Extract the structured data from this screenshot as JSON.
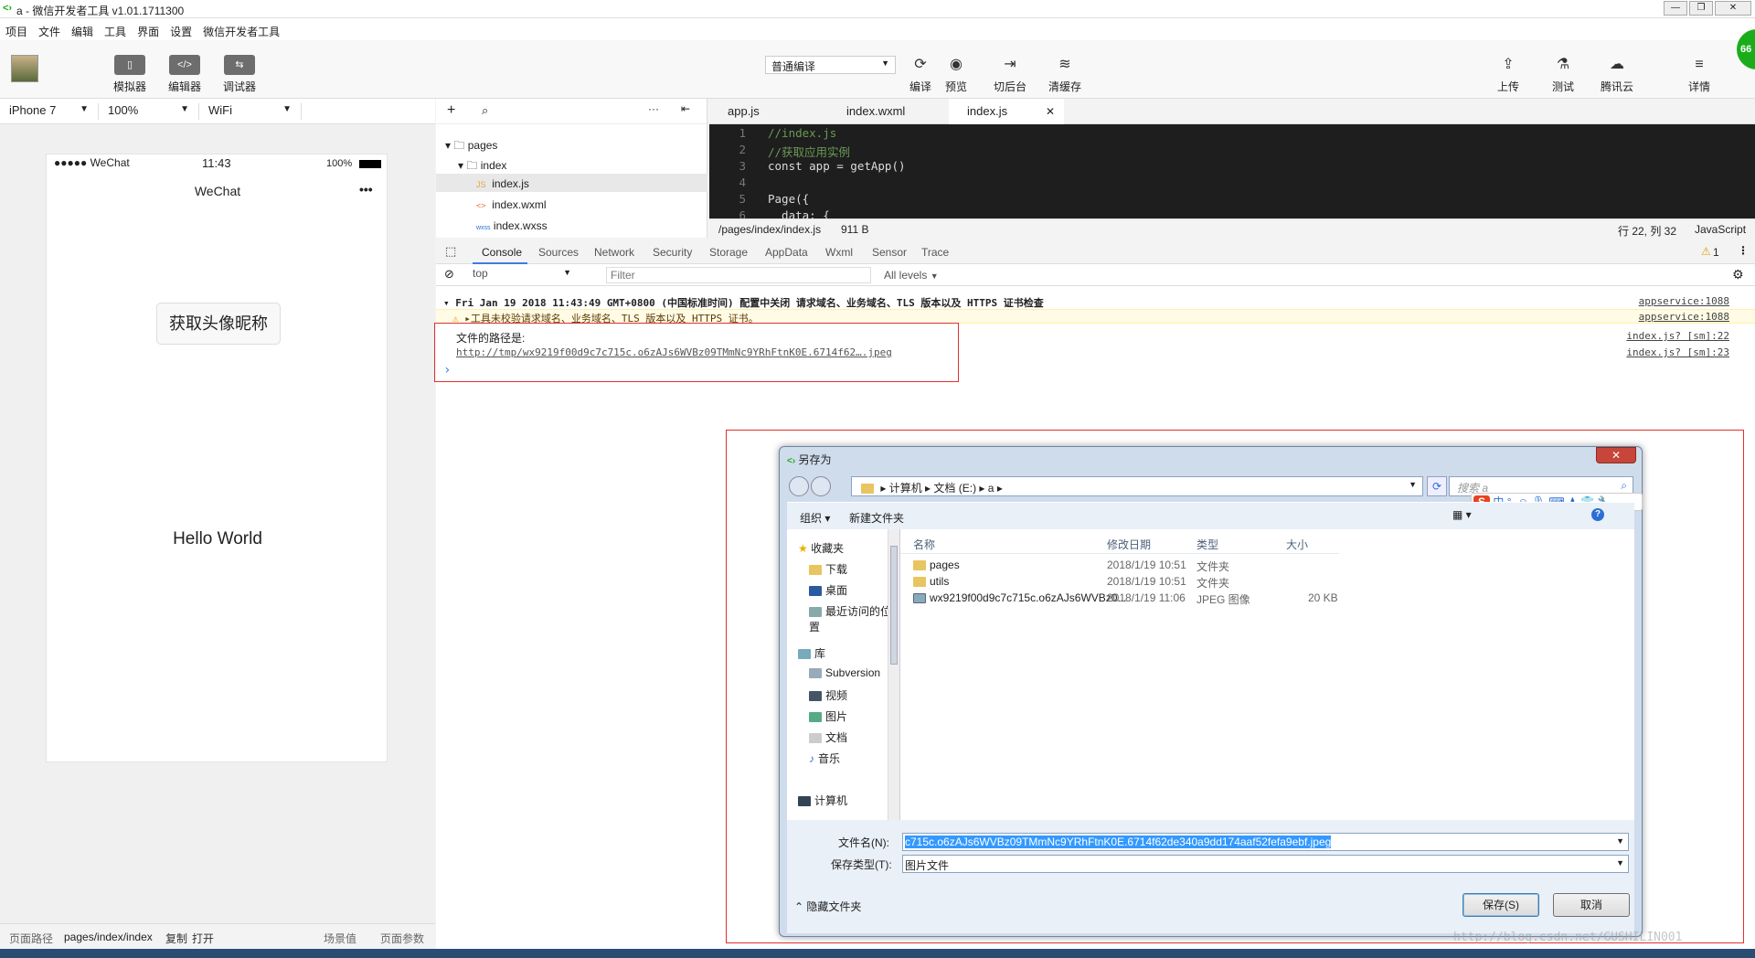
{
  "window": {
    "title": "a - 微信开发者工具 v1.01.1711300"
  },
  "menu": [
    "项目",
    "文件",
    "编辑",
    "工具",
    "界面",
    "设置",
    "微信开发者工具"
  ],
  "toolbar": {
    "simulator": "模拟器",
    "editor": "编辑器",
    "debugger": "调试器",
    "compile_mode": "普通编译",
    "compile": "编译",
    "preview": "预览",
    "background": "切后台",
    "clear_cache": "清缓存",
    "upload": "上传",
    "test": "测试",
    "tencent_cloud": "腾讯云",
    "details": "详情",
    "badge": "66"
  },
  "simulator": {
    "device": "iPhone 7",
    "zoom": "100%",
    "network": "WiFi",
    "status_carrier": "●●●●● WeChat",
    "status_time": "11:43",
    "status_battery": "100%",
    "nav_title": "WeChat",
    "nav_more": "•••",
    "button_label": "获取头像昵称",
    "hello": "Hello World"
  },
  "simfooter": {
    "path_label": "页面路径",
    "path": "pages/index/index",
    "copy": "复制",
    "open": "打开",
    "scene": "场景值",
    "params": "页面参数"
  },
  "filetree": {
    "root": "pages",
    "folder": "index",
    "files": [
      {
        "badge": "JS",
        "name": "index.js"
      },
      {
        "badge": "<>",
        "name": "index.wxml"
      },
      {
        "badge": "wxss",
        "name": "index.wxss"
      }
    ]
  },
  "tabs": [
    "app.js",
    "index.wxml",
    "index.js"
  ],
  "code": {
    "lines": [
      "1",
      "2",
      "3",
      "4",
      "5",
      "6"
    ],
    "text": [
      "//index.js",
      "//获取应用实例",
      "const app = getApp()",
      "",
      "Page({",
      "  data: {"
    ]
  },
  "editor_status": {
    "path": "/pages/index/index.js",
    "size": "911 B",
    "position": "行 22, 列 32",
    "language": "JavaScript"
  },
  "devtools": {
    "tabs": [
      "Console",
      "Sources",
      "Network",
      "Security",
      "Storage",
      "AppData",
      "Wxml",
      "Sensor",
      "Trace"
    ],
    "warn_count": "1",
    "context": "top",
    "filter_placeholder": "Filter",
    "levels": "All levels"
  },
  "console": {
    "line1": "Fri Jan 19 2018 11:43:49 GMT+0800 (中国标准时间) 配置中关闭 请求域名、业务域名、TLS 版本以及 HTTPS 证书检查",
    "line1_src": "appservice:1088",
    "line2": "▸工具未校验请求域名、业务域名、TLS 版本以及 HTTPS 证书。",
    "line2_src": "appservice:1088",
    "line3": "文件的路径是:",
    "line3_src": "index.js? [sm]:22",
    "line4": "http://tmp/wx9219f00d9c7c715c.o6zAJs6WVBz09TMmNc9YRhFtnK0E.6714f62….jpeg",
    "line4_src": "index.js? [sm]:23",
    "prompt": "›"
  },
  "dialog": {
    "title": "另存为",
    "close": "✕",
    "address": [
      "计算机",
      "文档 (E:)",
      "a"
    ],
    "search_placeholder": "搜索 a",
    "organize": "组织 ▾",
    "new_folder": "新建文件夹",
    "nav": {
      "favorites": "收藏夹",
      "downloads": "下载",
      "desktop": "桌面",
      "recent": "最近访问的位置",
      "libraries": "库",
      "subversion": "Subversion",
      "videos": "视频",
      "pictures": "图片",
      "docs": "文档",
      "music": "音乐",
      "computer": "计算机"
    },
    "columns": {
      "name": "名称",
      "date": "修改日期",
      "type": "类型",
      "size": "大小"
    },
    "files": [
      {
        "name": "pages",
        "date": "2018/1/19 10:51",
        "type": "文件夹",
        "size": ""
      },
      {
        "name": "utils",
        "date": "2018/1/19 10:51",
        "type": "文件夹",
        "size": ""
      },
      {
        "name": "wx9219f00d9c7c715c.o6zAJs6WVBz0...",
        "date": "2018/1/19 11:06",
        "type": "JPEG 图像",
        "size": "20 KB"
      }
    ],
    "filename_label": "文件名(N):",
    "filename": "c715c.o6zAJs6WVBz09TMmNc9YRhFtnK0E.6714f62de340a9dd174aaf52fefa9ebf.jpeg",
    "filetype_label": "保存类型(T):",
    "filetype": "图片文件",
    "hide_folders": "隐藏文件夹",
    "save": "保存(S)",
    "cancel": "取消"
  },
  "ime": {
    "label": "中"
  },
  "watermark": "http://blog.csdn.net/GUSHILIN001"
}
